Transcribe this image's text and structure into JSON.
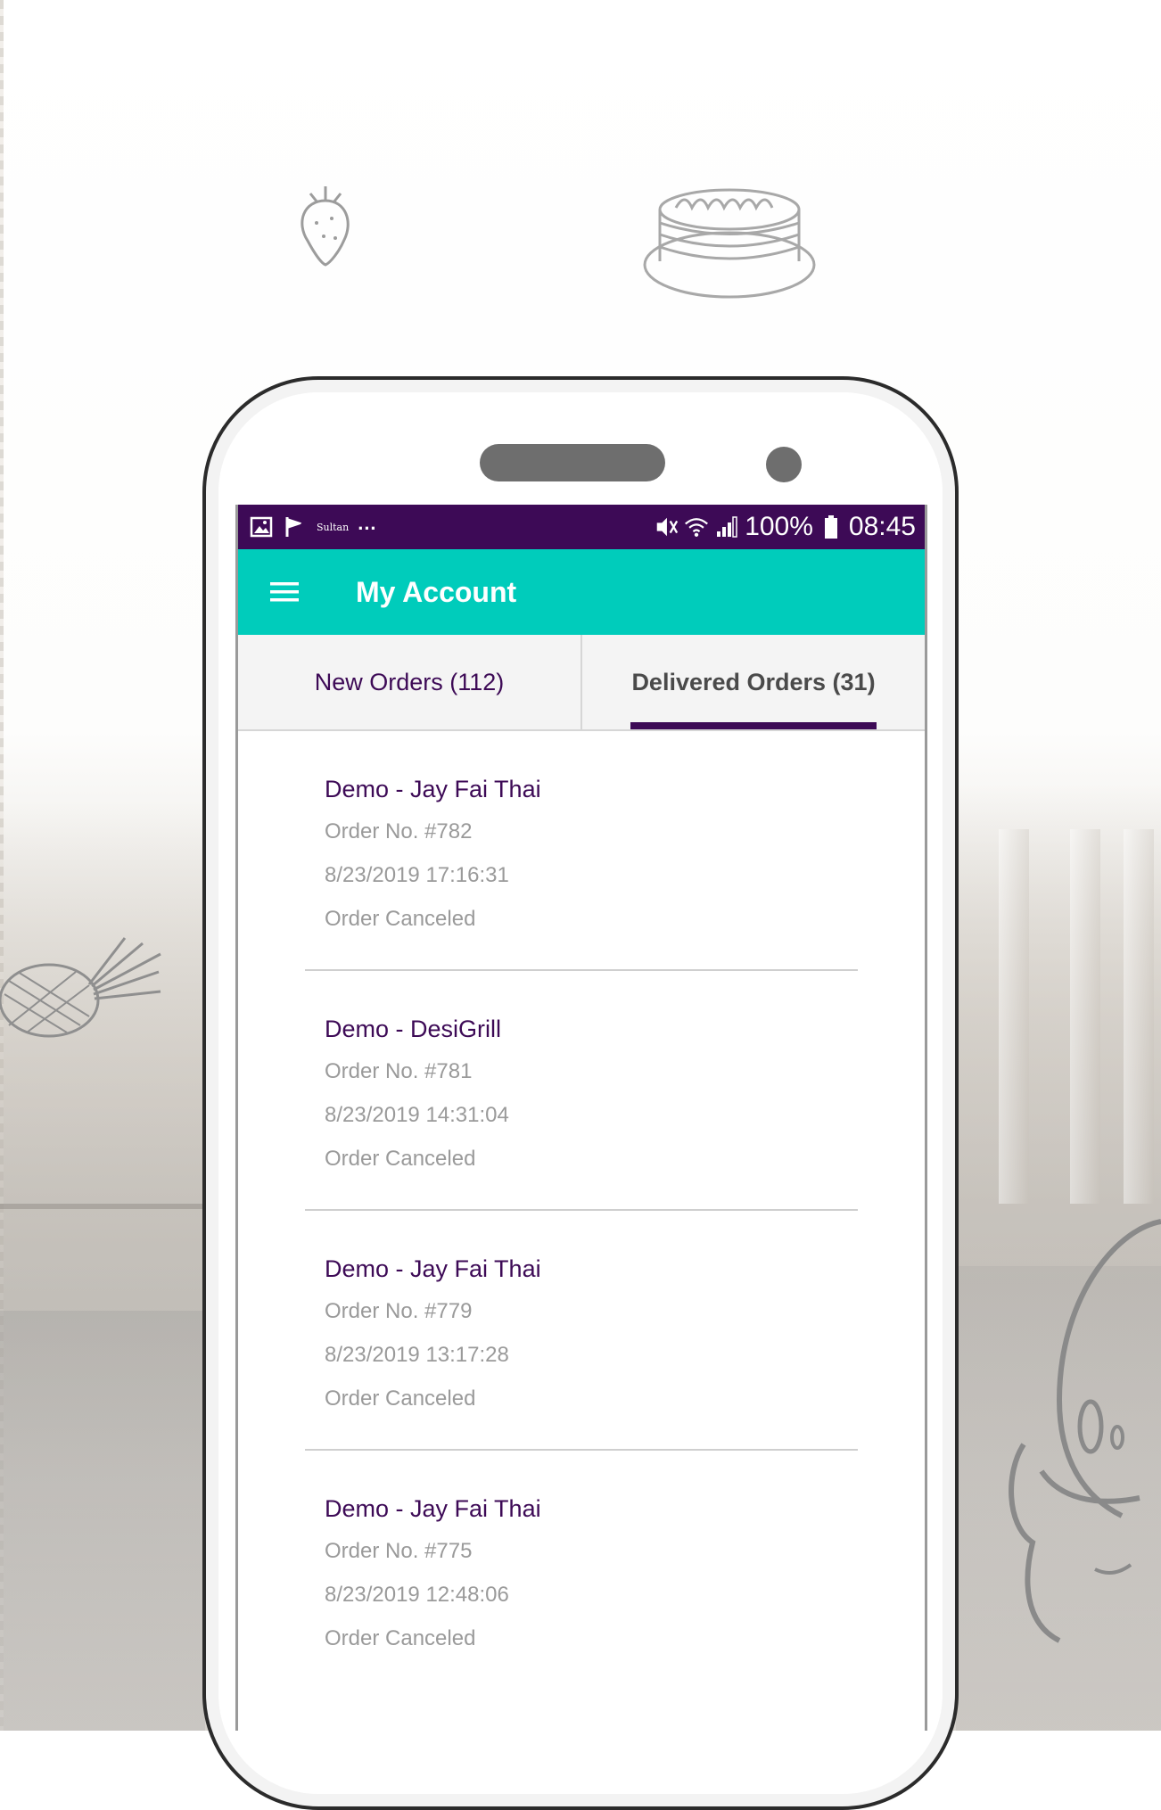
{
  "status_bar": {
    "icons": [
      "image-icon",
      "check-flag-icon",
      "brand-icon",
      "more-dots-icon",
      "mute-vibrate-icon",
      "wifi-icon",
      "signal-icon",
      "battery-icon"
    ],
    "brand_text": "Sultan",
    "more_text": "...",
    "battery_percent": "100%",
    "time": "08:45"
  },
  "toolbar": {
    "menu_icon": "hamburger-menu-icon",
    "title": "My Account"
  },
  "tabs": [
    {
      "label": "New Orders (112)",
      "active": false
    },
    {
      "label": "Delivered Orders (31)",
      "active": true
    }
  ],
  "orders": [
    {
      "restaurant": "Demo - Jay Fai Thai",
      "order_no": "Order No. #782",
      "datetime": "8/23/2019  17:16:31",
      "status": "Order Canceled"
    },
    {
      "restaurant": "Demo - DesiGrill",
      "order_no": "Order No. #781",
      "datetime": "8/23/2019  14:31:04",
      "status": "Order Canceled"
    },
    {
      "restaurant": "Demo - Jay Fai Thai",
      "order_no": "Order No. #779",
      "datetime": "8/23/2019  13:17:28",
      "status": "Order Canceled"
    },
    {
      "restaurant": "Demo - Jay Fai Thai",
      "order_no": "Order No. #775",
      "datetime": "8/23/2019  12:48:06",
      "status": "Order Canceled"
    }
  ],
  "colors": {
    "status_bar": "#3d0a56",
    "toolbar": "#00ccbb",
    "accent": "#3d0a56",
    "secondary_text": "#9a9a9a"
  },
  "decorations": [
    "strawberry-doodle",
    "pancake-stack-doodle",
    "pineapple-doodle",
    "mascot-doodle"
  ]
}
